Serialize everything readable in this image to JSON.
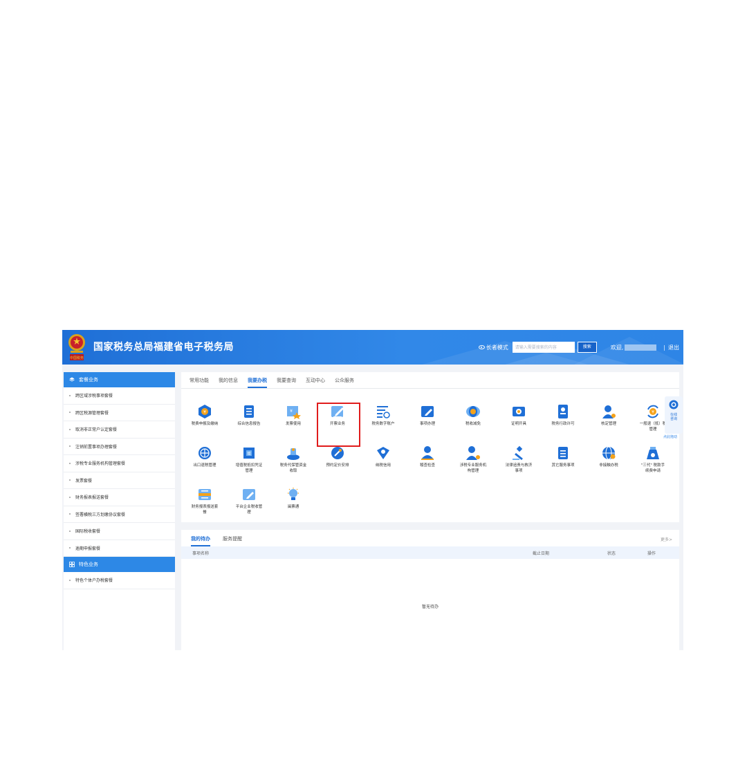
{
  "header": {
    "title": "国家税务总局福建省电子税务局",
    "elder_mode": "长者模式",
    "search_placeholder": "请输入需要搜索的内容",
    "search_button": "搜索",
    "welcome": "欢迎,",
    "separator": "|",
    "logout": "退出"
  },
  "sidebar": {
    "packages_title": "套餐业务",
    "packages": [
      "跨区域涉税事项套餐",
      "跨区税源管理套餐",
      "取消非正常户认定套餐",
      "注销前置事项办理套餐",
      "涉税专业服务机构管理套餐",
      "发票套餐",
      "财务报表报送套餐",
      "签署横税三方划缴协议套餐",
      "国际税收套餐",
      "逾期申报套餐"
    ],
    "special_title": "特色业务",
    "special": [
      "特色个体户办税套餐"
    ]
  },
  "main": {
    "tabs": [
      "常用功能",
      "我的信息",
      "我要办税",
      "我要查询",
      "互动中心",
      "公众服务"
    ],
    "active_tab": "我要办税",
    "tiles_row1": [
      {
        "label": "税费申报及缴纳",
        "icon": "tax-declare-icon"
      },
      {
        "label": "综合信息报告",
        "icon": "info-report-icon"
      },
      {
        "label": "发票使用",
        "icon": "invoice-use-icon"
      },
      {
        "label": "开票业务",
        "icon": "invoicing-icon"
      },
      {
        "label": "税务数字账户",
        "icon": "digital-account-icon"
      },
      {
        "label": "事项办理",
        "icon": "matter-icon"
      },
      {
        "label": "税收减免",
        "icon": "tax-reduction-icon"
      },
      {
        "label": "证明开具",
        "icon": "certificate-icon"
      },
      {
        "label": "税务行政许可",
        "icon": "admin-license-icon"
      },
      {
        "label": "核定管理",
        "icon": "assessment-icon"
      },
      {
        "label": "一般退（抵）税",
        "label2": "管理",
        "icon": "refund-icon"
      }
    ],
    "tiles_row2": [
      {
        "label": "出口退税管理",
        "icon": "export-refund-icon"
      },
      {
        "label": "增值税抵扣凭证",
        "label2": "管理",
        "icon": "vat-deduction-icon"
      },
      {
        "label": "税务代保管资金",
        "label2": "收取",
        "icon": "custody-fund-icon"
      },
      {
        "label": "预约定价安排",
        "icon": "pricing-icon"
      },
      {
        "label": "纳税信用",
        "icon": "credit-icon"
      },
      {
        "label": "稽查检查",
        "icon": "inspection-icon"
      },
      {
        "label": "涉税专业服务机",
        "label2": "构管理",
        "icon": "agency-icon"
      },
      {
        "label": "法律追责与救济",
        "label2": "事项",
        "icon": "legal-icon"
      },
      {
        "label": "其它服务事项",
        "icon": "other-service-icon"
      },
      {
        "label": "非接触办税",
        "icon": "contactless-icon"
      },
      {
        "label": "\"三代\" 税款手",
        "label2": "续费申请",
        "icon": "fee-icon"
      }
    ],
    "tiles_row3": [
      {
        "label": "财务报表报送套",
        "label2": "餐",
        "icon": "financial-report-icon"
      },
      {
        "label": "平台企业税收管",
        "label2": "理",
        "icon": "platform-tax-icon"
      },
      {
        "label": "闽票通",
        "icon": "mpt-icon"
      }
    ]
  },
  "float": {
    "label": "在线咨询",
    "drag_hint": "点此拖动"
  },
  "todo": {
    "tabs": [
      "我的待办",
      "服务提醒"
    ],
    "more": "更多>",
    "columns": [
      "事项名称",
      "截止日期",
      "状态",
      "操作"
    ],
    "empty": "暂无待办"
  },
  "colors": {
    "brand": "#1f6fd6",
    "highlight": "#e01b1b"
  }
}
